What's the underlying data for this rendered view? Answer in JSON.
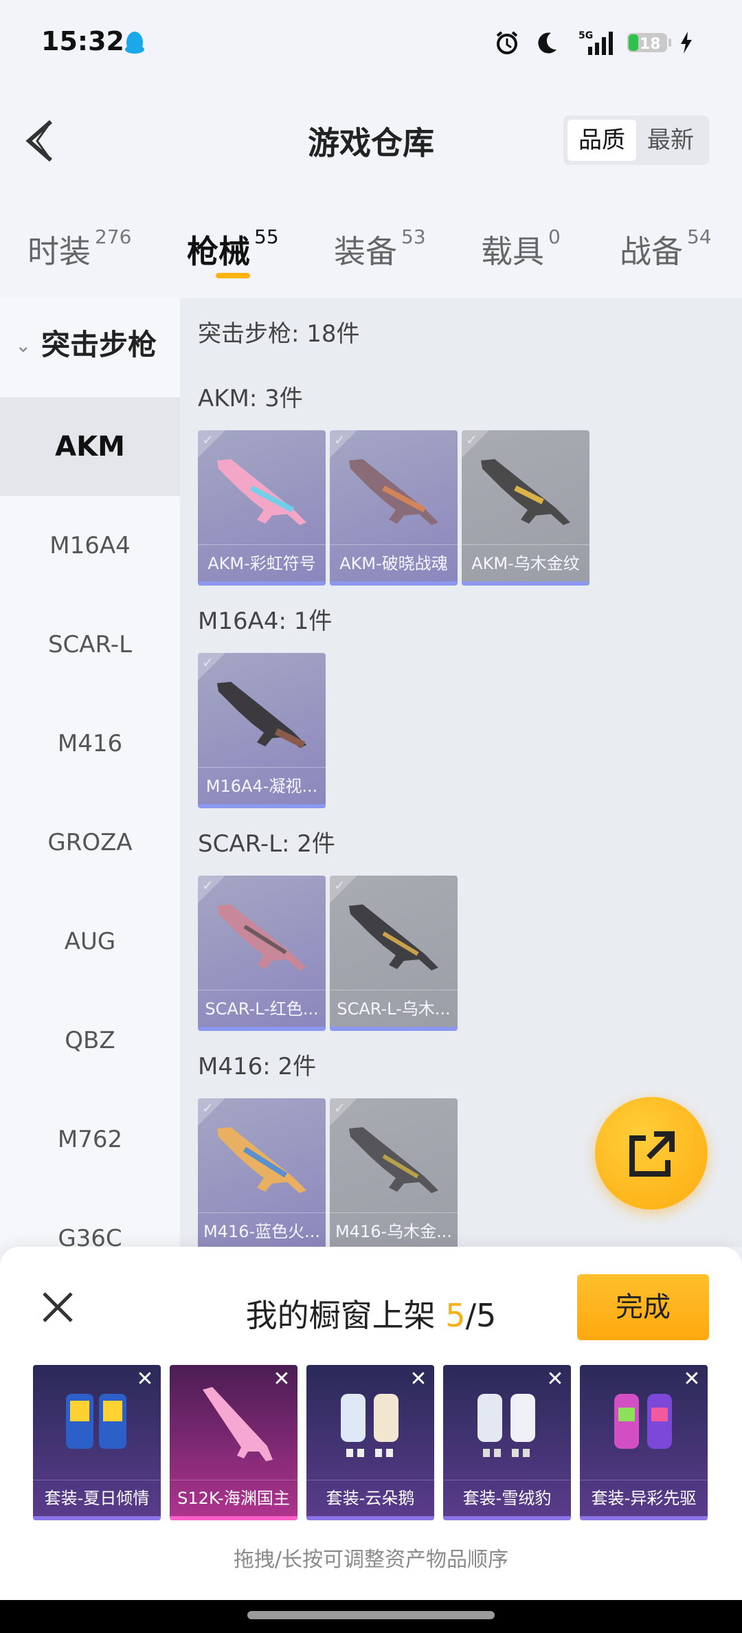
{
  "status_bar": {
    "time": "15:32",
    "battery": "18",
    "network": "5G",
    "icons": [
      "qq-penguin-icon",
      "alarm-icon",
      "moon-icon",
      "signal-icon",
      "battery-icon",
      "charging-icon"
    ]
  },
  "header": {
    "title": "游戏仓库",
    "sort_options": [
      "品质",
      "最新"
    ],
    "sort_selected": "品质"
  },
  "tabs": [
    {
      "label": "时装",
      "count": "276"
    },
    {
      "label": "枪械",
      "count": "55"
    },
    {
      "label": "装备",
      "count": "53"
    },
    {
      "label": "载具",
      "count": "0"
    },
    {
      "label": "战备",
      "count": "54"
    }
  ],
  "active_tab": "枪械",
  "sidebar": {
    "category": "突击步枪",
    "items": [
      "AKM",
      "M16A4",
      "SCAR-L",
      "M416",
      "GROZA",
      "AUG",
      "QBZ",
      "M762",
      "G36C"
    ],
    "active": "AKM"
  },
  "content": {
    "summary": "突击步枪: 18件",
    "sections": [
      {
        "title": "AKM: 3件",
        "items": [
          {
            "name": "AKM-彩虹符号",
            "tone": "purple"
          },
          {
            "name": "AKM-破晓战魂",
            "tone": "purple"
          },
          {
            "name": "AKM-乌木金纹",
            "tone": "gray"
          }
        ]
      },
      {
        "title": "M16A4: 1件",
        "items": [
          {
            "name": "M16A4-凝视...",
            "tone": "purple"
          }
        ]
      },
      {
        "title": "SCAR-L: 2件",
        "items": [
          {
            "name": "SCAR-L-红色...",
            "tone": "purple"
          },
          {
            "name": "SCAR-L-乌木...",
            "tone": "gray"
          }
        ]
      },
      {
        "title": "M416: 2件",
        "items": [
          {
            "name": "M416-蓝色火...",
            "tone": "purple"
          },
          {
            "name": "M416-乌木金...",
            "tone": "gray"
          }
        ]
      }
    ]
  },
  "showcase": {
    "title_prefix": "我的橱窗上架 ",
    "current": "5",
    "total": "/5",
    "done_label": "完成",
    "items": [
      {
        "name": "套装-夏日倾情"
      },
      {
        "name": "S12K-海渊国主"
      },
      {
        "name": "套装-云朵鹅"
      },
      {
        "name": "套装-雪绒豹"
      },
      {
        "name": "套装-异彩先驱"
      }
    ],
    "hint": "拖拽/长按可调整资产物品顺序"
  }
}
